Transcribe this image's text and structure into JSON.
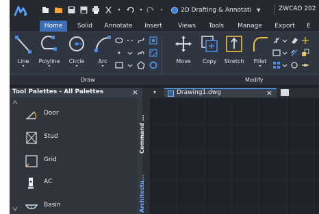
{
  "titlebar": {
    "workspace": "2D Drafting & Annotati",
    "app_title": "ZWCAD 202"
  },
  "tabs": [
    {
      "label": "Home",
      "active": true
    },
    {
      "label": "Solid"
    },
    {
      "label": "Annotate"
    },
    {
      "label": "Insert"
    },
    {
      "label": "Views"
    },
    {
      "label": "Tools"
    },
    {
      "label": "Manage"
    },
    {
      "label": "Export"
    },
    {
      "label": "E"
    }
  ],
  "ribbon": {
    "draw": {
      "buttons": [
        {
          "label": "Line",
          "icon": "line-icon"
        },
        {
          "label": "Polyline",
          "icon": "polyline-icon"
        },
        {
          "label": "Circle",
          "icon": "circle-icon"
        },
        {
          "label": "Arc",
          "icon": "arc-icon"
        }
      ],
      "panel_label": "Draw"
    },
    "modify": {
      "buttons": [
        {
          "label": "Move",
          "icon": "move-icon"
        },
        {
          "label": "Copy",
          "icon": "copy-icon"
        },
        {
          "label": "Stretch",
          "icon": "stretch-icon"
        },
        {
          "label": "Fillet",
          "icon": "fillet-icon"
        }
      ],
      "panel_label": "Modify"
    }
  },
  "palette": {
    "title": "Tool Palettes - All Palettes",
    "close": "×",
    "tools": [
      {
        "label": "Door",
        "icon": "door-icon"
      },
      {
        "label": "Stud",
        "icon": "stud-icon"
      },
      {
        "label": "Grid",
        "icon": "grid-icon"
      },
      {
        "label": "AC",
        "icon": "ac-icon"
      },
      {
        "label": "Basin",
        "icon": "basin-icon"
      }
    ],
    "vertical_tabs": {
      "command": "Command ...",
      "architecture": "Architectu..."
    }
  },
  "document": {
    "tab_name": "Drawing1.dwg",
    "close": "×",
    "menu_glyph": "▾"
  },
  "colors": {
    "accent": "#3a6fb5",
    "panel_bg": "#2f3541",
    "canvas_bg": "#1f2329",
    "vtab_blue": "#6ea8ff"
  }
}
